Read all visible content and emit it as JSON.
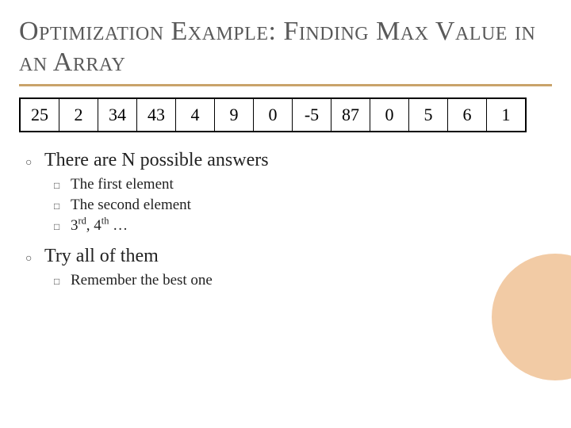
{
  "title": "Optimization Example: Finding Max Value in an Array",
  "array": [
    "25",
    "2",
    "34",
    "43",
    "4",
    "9",
    "0",
    "-5",
    "87",
    "0",
    "5",
    "6",
    "1"
  ],
  "bullets": {
    "b0": "There are N possible answers",
    "b0_subs": {
      "s0": "The first element",
      "s1": "The second element",
      "s2_prefix": "3",
      "s2_ord1": "rd",
      "s2_mid": ", 4",
      "s2_ord2": "th",
      "s2_suffix": " …"
    },
    "b1": "Try all of them",
    "b1_subs": {
      "s0": "Remember the best one"
    }
  }
}
